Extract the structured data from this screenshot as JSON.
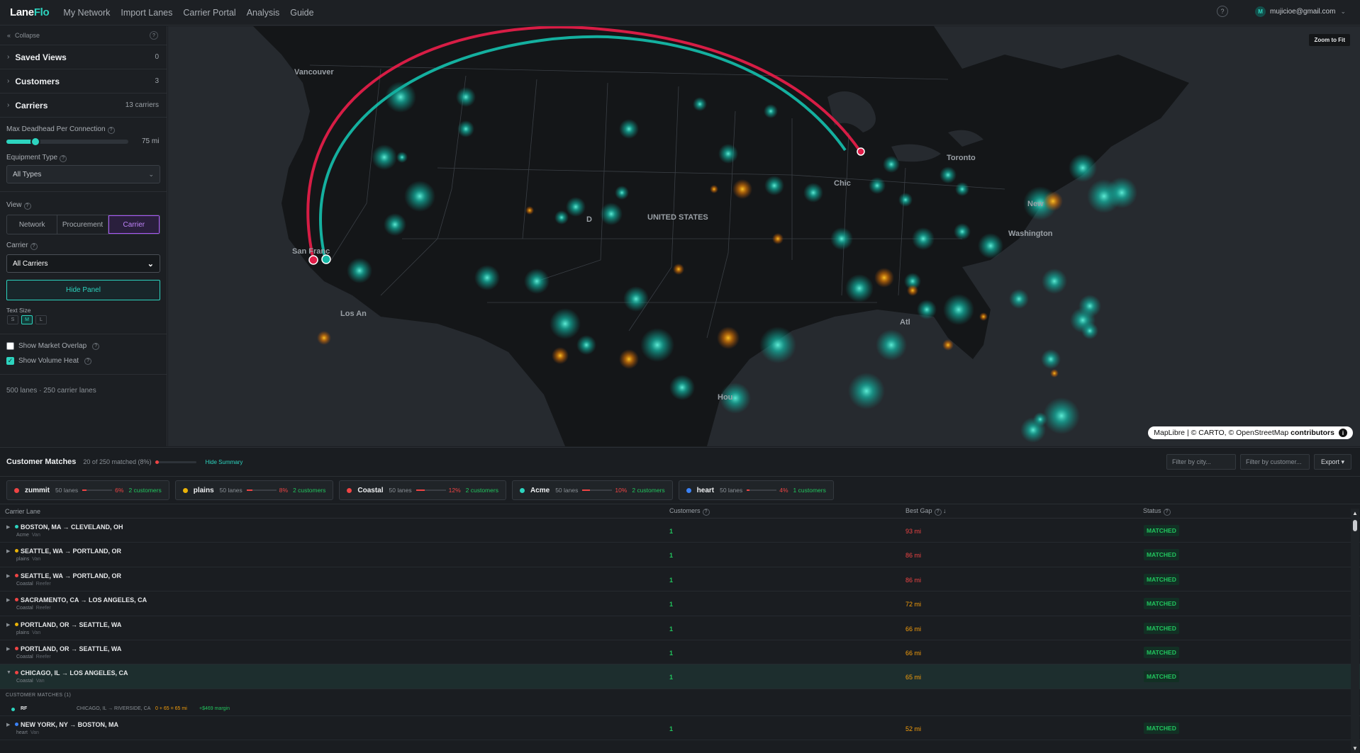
{
  "app": {
    "logo_main": "Lane",
    "logo_accent": "Flo"
  },
  "nav": [
    "My Network",
    "Import Lanes",
    "Carrier Portal",
    "Analysis",
    "Guide"
  ],
  "user": {
    "help": "?",
    "avatar": "M",
    "email": "mujicioe@gmail.com"
  },
  "sidebar": {
    "collapse": "Collapse",
    "sections": [
      {
        "title": "Saved Views",
        "count": "0"
      },
      {
        "title": "Customers",
        "count": "3"
      },
      {
        "title": "Carriers",
        "count": "13 carriers"
      }
    ],
    "deadhead_label": "Max Deadhead Per Connection",
    "deadhead_value": "75 mi",
    "deadhead_fraction": 0.24,
    "equipment_label": "Equipment Type",
    "equipment_value": "All Types",
    "view_label": "View",
    "views": [
      "Network",
      "Procurement",
      "Carrier"
    ],
    "active_view": "Carrier",
    "carrier_label": "Carrier",
    "carrier_value": "All Carriers",
    "hide_panel": "Hide Panel",
    "text_size_label": "Text Size",
    "text_sizes": [
      "S",
      "M",
      "L"
    ],
    "active_size": "M",
    "show_market": "Show Market Overlap",
    "show_volume": "Show Volume Heat",
    "lane_count": "500 lanes · 250 carrier lanes"
  },
  "map": {
    "zoom": "Zoom to Fit",
    "attribution_a": "MapLibre | © CARTO, © OpenStreetMap",
    "attribution_b": "contributors",
    "labels": [
      "Vancouver",
      "Toronto",
      "UNITED STATES",
      "San Franc",
      "Washington",
      "Los An",
      "Chic",
      "New",
      "Atl",
      "Hou",
      "D"
    ]
  },
  "bottom": {
    "title": "Customer Matches",
    "summary": "20 of 250 matched (8%)",
    "hide_summary": "Hide Summary",
    "filter_city": "Filter by city...",
    "filter_customer": "Filter by customer...",
    "export": "Export ▾",
    "chips": [
      {
        "name": "zummit",
        "lanes": "50 lanes",
        "pct": "6%",
        "pct_value": 6,
        "customers": "2 customers",
        "color": "#ef4444"
      },
      {
        "name": "plains",
        "lanes": "50 lanes",
        "pct": "8%",
        "pct_value": 8,
        "customers": "2 customers",
        "color": "#eab308"
      },
      {
        "name": "Coastal",
        "lanes": "50 lanes",
        "pct": "12%",
        "pct_value": 12,
        "customers": "2 customers",
        "color": "#ef4444"
      },
      {
        "name": "Acme",
        "lanes": "50 lanes",
        "pct": "10%",
        "pct_value": 10,
        "customers": "2 customers",
        "color": "#2dd4bf"
      },
      {
        "name": "heart",
        "lanes": "50 lanes",
        "pct": "4%",
        "pct_value": 4,
        "customers": "1 customers",
        "color": "#3b82f6"
      }
    ],
    "columns": [
      "Carrier Lane",
      "Customers",
      "Best Gap",
      "Status"
    ],
    "rows": [
      {
        "route": "BOSTON, MA → CLEVELAND, OH",
        "carrier": "Acme",
        "equip": "Van",
        "customers": "1",
        "gap": "93 mi",
        "gap_color": "#ef4444",
        "status": "MATCHED",
        "dot": "#2dd4bf"
      },
      {
        "route": "SEATTLE, WA → PORTLAND, OR",
        "carrier": "plains",
        "equip": "Van",
        "customers": "1",
        "gap": "86 mi",
        "gap_color": "#ef4444",
        "status": "MATCHED",
        "dot": "#eab308"
      },
      {
        "route": "SEATTLE, WA → PORTLAND, OR",
        "carrier": "Coastal",
        "equip": "Reefer",
        "customers": "1",
        "gap": "86 mi",
        "gap_color": "#ef4444",
        "status": "MATCHED",
        "dot": "#ef4444"
      },
      {
        "route": "SACRAMENTO, CA → LOS ANGELES, CA",
        "carrier": "Coastal",
        "equip": "Reefer",
        "customers": "1",
        "gap": "72 mi",
        "gap_color": "#f59e0b",
        "status": "MATCHED",
        "dot": "#ef4444"
      },
      {
        "route": "PORTLAND, OR → SEATTLE, WA",
        "carrier": "plains",
        "equip": "Van",
        "customers": "1",
        "gap": "66 mi",
        "gap_color": "#f59e0b",
        "status": "MATCHED",
        "dot": "#eab308"
      },
      {
        "route": "PORTLAND, OR → SEATTLE, WA",
        "carrier": "Coastal",
        "equip": "Reefer",
        "customers": "1",
        "gap": "66 mi",
        "gap_color": "#f59e0b",
        "status": "MATCHED",
        "dot": "#ef4444"
      },
      {
        "route": "CHICAGO, IL → LOS ANGELES, CA",
        "carrier": "Coastal",
        "equip": "Van",
        "customers": "1",
        "gap": "65 mi",
        "gap_color": "#f59e0b",
        "status": "MATCHED",
        "dot": "#ef4444"
      }
    ],
    "sub_header": "CUSTOMER MATCHES (1)",
    "sub_match": {
      "name": "RF",
      "route": "CHICAGO, IL → RIVERSIDE, CA",
      "gap": "0 + 65 = 65 mi",
      "margin": "+$469 margin"
    },
    "last_row": {
      "route": "NEW YORK, NY → BOSTON, MA",
      "carrier": "heart",
      "equip": "Van",
      "customers": "1",
      "gap": "52 mi",
      "gap_color": "#f59e0b",
      "status": "MATCHED",
      "dot": "#3b82f6"
    }
  }
}
